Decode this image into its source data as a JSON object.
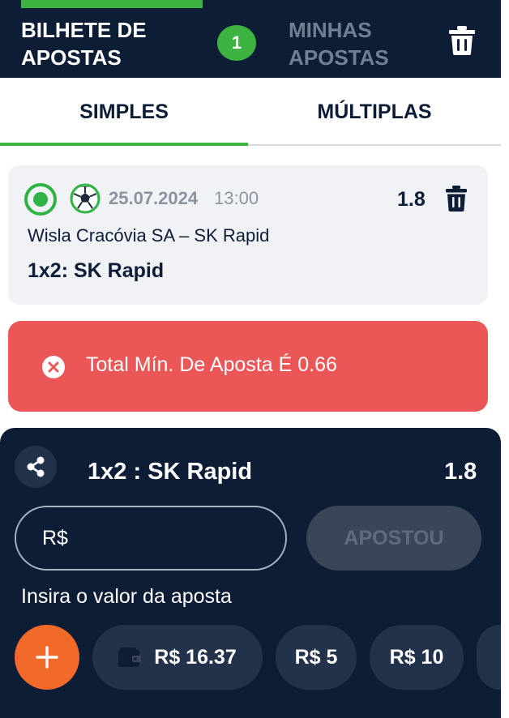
{
  "header": {
    "slip_tab_label": "BILHETE DE APOSTAS",
    "slip_count": "1",
    "my_bets_tab_label": "MINHAS APOSTAS"
  },
  "bet_type_tabs": {
    "simples": "SIMPLES",
    "multiplas": "MÚLTIPLAS",
    "active": "SIMPLES"
  },
  "selection": {
    "sport_icon": "soccer-ball-icon",
    "date": "25.07.2024",
    "time": "13:00",
    "odds": "1.8",
    "event": "Wisla Cracóvia SA – SK Rapid",
    "market_pick": "1x2: SK Rapid"
  },
  "error": {
    "message": "Total Mín. De Aposta É 0.66"
  },
  "bet_panel": {
    "pick_label": "1x2 : SK Rapid",
    "odds": "1.8",
    "stake_placeholder": "R$",
    "place_button_label": "APOSTOU",
    "stake_hint": "Insira o valor da aposta",
    "quick_stakes": {
      "balance": "R$ 16.37",
      "five": "R$ 5",
      "ten": "R$ 10"
    }
  },
  "colors": {
    "navy": "#0e1d36",
    "green": "#3db342",
    "error_red": "#eb5656",
    "orange": "#f26a2a",
    "card_bg": "#f1f2f6"
  }
}
